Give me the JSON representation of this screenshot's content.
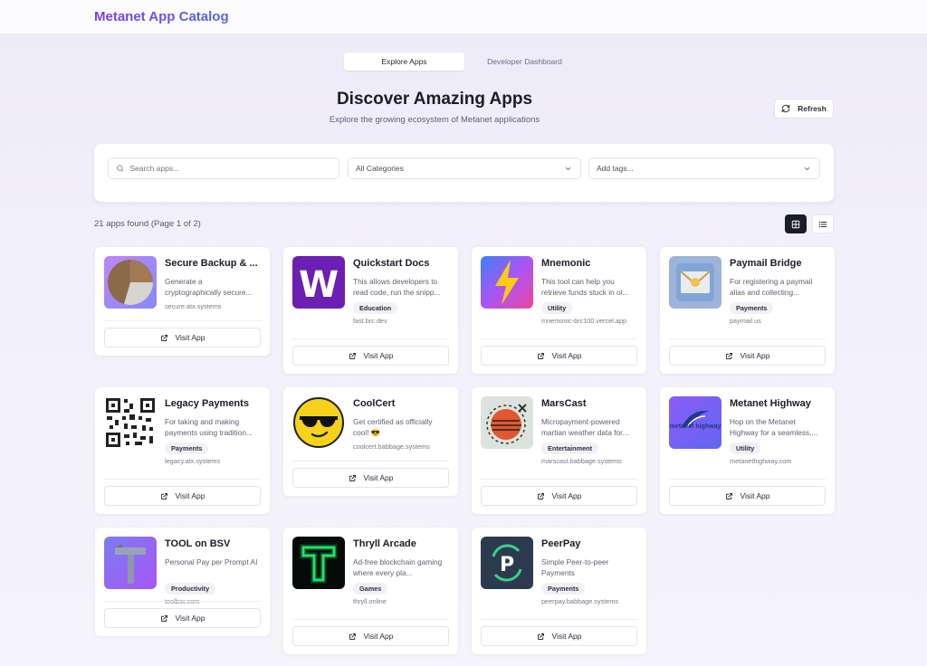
{
  "app": {
    "title": "Metanet App Catalog"
  },
  "tabs": [
    {
      "label": "Explore Apps",
      "active": true
    },
    {
      "label": "Developer Dashboard",
      "active": false
    }
  ],
  "hero": {
    "title": "Discover Amazing Apps",
    "subtitle": "Explore the growing ecosystem of Metanet applications"
  },
  "refresh": {
    "label": "Refresh",
    "icon": "refresh-icon"
  },
  "filters": {
    "search_placeholder": "Search apps...",
    "category": "All Categories",
    "tags_placeholder": "Add tags..."
  },
  "results": {
    "summary": "21 apps found (Page 1 of 2)"
  },
  "view_toggle": {
    "active": "grid",
    "options": [
      "grid-view-icon",
      "list-view-icon"
    ]
  },
  "visit_label": "Visit App",
  "apps": [
    {
      "name": "Secure Backup & ...",
      "description": "Generate a cryptographically secure...",
      "tag": "",
      "domain": "secure.atx.systems",
      "icon": "pie-chart-logo"
    },
    {
      "name": "Quickstart Docs",
      "description": "This allows developers to read code, run the snipp...",
      "tag": "Education",
      "domain": "fast.brc.dev",
      "icon": "letter-w-logo"
    },
    {
      "name": "Mnemonic",
      "description": "This tool can help you retrieve funds stuck in ol...",
      "tag": "Utility",
      "domain": "mnemonic-brc100.vercel.app",
      "icon": "lightning-bolt-logo"
    },
    {
      "name": "Paymail Bridge",
      "description": "For registering a paymail alias and collecting...",
      "tag": "Payments",
      "domain": "paymail.us",
      "icon": "envelope-logo"
    },
    {
      "name": "Legacy Payments",
      "description": "For taking and making payments using tradition...",
      "tag": "Payments",
      "domain": "legacy.atx.systems",
      "icon": "qr-code-logo"
    },
    {
      "name": "CoolCert",
      "description": "Get certified as officially cool! 😎",
      "tag": "",
      "domain": "coolcert.babbage.systems",
      "icon": "sunglasses-face-logo"
    },
    {
      "name": "MarsCast",
      "description": "Micropayment-powered martian weather data for...",
      "tag": "Entertainment",
      "domain": "marscast.babbage.systems",
      "icon": "planet-logo"
    },
    {
      "name": "Metanet Highway",
      "description": "Hop on the Metanet Highway for a seamless,...",
      "tag": "Utility",
      "domain": "metanethighway.com",
      "icon": "highway-logo",
      "logo_text": "metanet highway"
    },
    {
      "name": "TOOL on BSV",
      "description": "Personal Pay per Prompt AI",
      "tag": "Productivity",
      "domain": "toolbsv.com",
      "icon": "hammer-logo"
    },
    {
      "name": "Thryll Arcade",
      "description": "Ad-free blockchain gaming where every pla...",
      "tag": "Games",
      "domain": "thryll.online",
      "icon": "neon-t-logo"
    },
    {
      "name": "PeerPay",
      "description": "Simple Peer-to-peer Payments",
      "tag": "Payments",
      "domain": "peerpay.babbage.systems",
      "icon": "peerpay-p-logo"
    }
  ]
}
